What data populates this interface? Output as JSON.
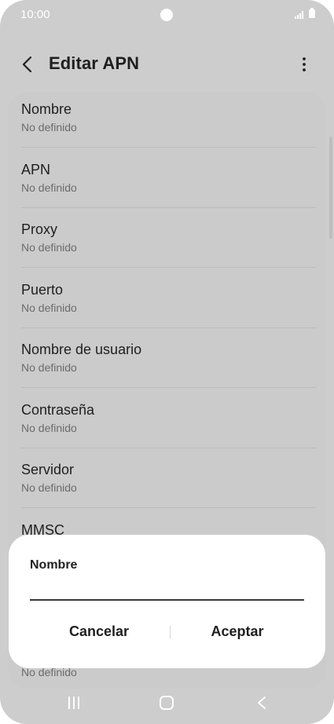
{
  "status_bar": {
    "time": "10:00",
    "icons": [
      "signal-icon",
      "battery-icon"
    ]
  },
  "header": {
    "title": "Editar APN",
    "back_icon": "chevron-left-icon",
    "more_icon": "more-vertical-icon"
  },
  "list": {
    "items": [
      {
        "title": "Nombre",
        "subtitle": "No definido"
      },
      {
        "title": "APN",
        "subtitle": "No definido"
      },
      {
        "title": "Proxy",
        "subtitle": "No definido"
      },
      {
        "title": "Puerto",
        "subtitle": "No definido"
      },
      {
        "title": "Nombre de usuario",
        "subtitle": "No definido"
      },
      {
        "title": "Contraseña",
        "subtitle": "No definido"
      },
      {
        "title": "Servidor",
        "subtitle": "No definido"
      },
      {
        "title": "MMSC",
        "subtitle": "No definido"
      }
    ]
  },
  "dialog": {
    "title": "Nombre",
    "input_value": "",
    "cancel_label": "Cancelar",
    "accept_label": "Aceptar"
  },
  "nav_bar": {
    "icons": [
      "recents-icon",
      "home-icon",
      "back-icon"
    ]
  },
  "colors": {
    "overlay_background": "#cdcdcd",
    "dialog_background": "#ffffff",
    "text_primary": "#1f1f1f",
    "text_secondary": "#6b6b6b"
  }
}
